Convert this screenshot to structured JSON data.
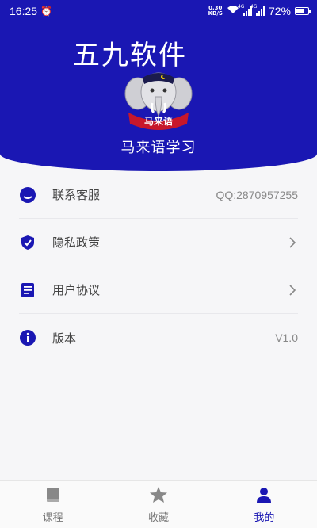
{
  "status_bar": {
    "time": "16:25",
    "speed_value": "0.30",
    "speed_unit": "KB/S",
    "network_1": "4G",
    "network_2": "4G",
    "battery": "72%",
    "battery_level": 0.72
  },
  "header": {
    "watermark": "五九软件",
    "logo_text": "马来语",
    "app_name": "马来语学习"
  },
  "colors": {
    "brand": "#1a17b3",
    "logo_banner": "#c7172b"
  },
  "settings": [
    {
      "label": "联系客服",
      "value": "QQ:2870957255",
      "icon": "chat-icon"
    },
    {
      "label": "隐私政策",
      "value": "",
      "icon": "shield-check-icon"
    },
    {
      "label": "用户协议",
      "value": "",
      "icon": "document-icon"
    },
    {
      "label": "版本",
      "value": "V1.0",
      "icon": "info-icon"
    }
  ],
  "bottom_nav": [
    {
      "label": "课程",
      "icon": "book-icon",
      "active": false
    },
    {
      "label": "收藏",
      "icon": "star-icon",
      "active": false
    },
    {
      "label": "我的",
      "icon": "person-icon",
      "active": true
    }
  ]
}
